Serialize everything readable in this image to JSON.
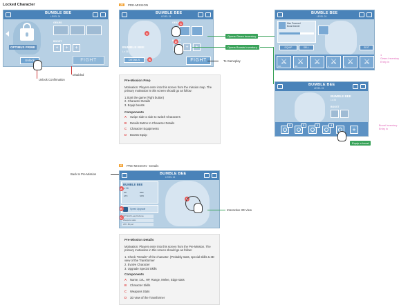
{
  "colors": {
    "accent": "#4a83b9",
    "callout": "#3aa35a",
    "marker": "#e85a5a",
    "pink": "#e05fb5",
    "badge": "#f3a53a"
  },
  "locked": {
    "section_title": "Locked Character",
    "char_title": "BUMBLE BEE",
    "char_level": "LEVEL 24",
    "gears": "GEARS",
    "boost": "BOOST",
    "name": "OPTIMUS PRIME",
    "unlock": "Unlock",
    "fight": "FIGHT",
    "unlock_note": "Unlock Confirmation",
    "disabled_note": "Disabled",
    "icon": "lock-icon"
  },
  "premission": {
    "badge": "22",
    "title": "PRE-MISSION",
    "char_title": "BUMBLE BEE",
    "char_level": "LEVEL 24",
    "gears": "GEARS",
    "boost": "BOOST",
    "name": "BUMBLE BEE",
    "lv": "Lv 26",
    "details": "DETAILS",
    "fight": "FIGHT",
    "to_gameplay": "To Gameplay",
    "opens_gears": "Opens Gears Inventory",
    "opens_boosts": "Opens Boosts Inventory",
    "markers": {
      "a": "A",
      "b": "B",
      "c": "C",
      "d": "D"
    }
  },
  "prep": {
    "heading": "Pre-Mission Prep",
    "motivation": "Motivation: Players enter into this screen from the mission map. The primary motivation is this screen should go as follow:",
    "steps": [
      "1.Start the game (Fight button)",
      "2. Character Details",
      "3. Equip boosts"
    ],
    "components_title": "Components",
    "components": [
      {
        "key": "A",
        "text": "Swipe side to side to switch Characters"
      },
      {
        "key": "B",
        "text": "Details Button to Character Details"
      },
      {
        "key": "C",
        "text": "Character Equipments"
      },
      {
        "key": "D",
        "text": "Boosts Equip"
      }
    ]
  },
  "gears_inv": {
    "char_title": "BUMBLE BEE",
    "char_level": "LEVEL 24",
    "stat1": "Max Powered",
    "stat2": "Boost Damet",
    "equip": "EQUIP",
    "sell": "SELL",
    "edit": "EDIT",
    "weapon_labels": [
      "UC",
      "UC",
      "L",
      "L"
    ],
    "note": "1\nGears Inventory\nEntry in"
  },
  "boost_inv": {
    "char_title": "BUMBLE BEE",
    "char_level": "LEVEL 24",
    "name": "BUMBLE BEE",
    "lv": "Lv 26",
    "boost": "BOOST",
    "badges": [
      "2",
      "3",
      "1",
      "4"
    ],
    "equip_callout": "Equip a boost",
    "note": "Boost Inventory\nEntry in"
  },
  "details": {
    "badge": "6",
    "title": "PRE-MISSION - Details",
    "back_note": "Back to Pre-Mission",
    "char_title": "BUMBLE BEE",
    "char_level": "LEVEL 24",
    "name": "BUMBLE BEE",
    "lv": "Lv 26",
    "stats": [
      "HP",
      "ATK",
      "DEF",
      "SPD"
    ],
    "skill_label": "Speed Upgrade",
    "weapon_rows": [
      "HP:Stitch Leap Defense",
      "Weapons stats",
      "ATK: 80 pwr"
    ],
    "view_note": "Interactive 3D View",
    "markers": {
      "a": "A",
      "b": "B",
      "c": "C",
      "d": "D"
    }
  },
  "details_doc": {
    "heading": "Pre-Mission Details",
    "motivation": "Motivation: Players enter into this screen from the Pre-Mission. The primary motivation in this screen should go as follow:",
    "steps": [
      "1. Check \"Details\" of the character. (Probably stats, special skills & 3D view of the Transformer",
      "2. Evolve Character",
      "3. Upgrade Special Skills"
    ],
    "components_title": "Components",
    "components": [
      {
        "key": "A",
        "text": "Name, LVL, HP, Range, Melee, Edge stats"
      },
      {
        "key": "B",
        "text": "Character Skills"
      },
      {
        "key": "C",
        "text": "Weapons Stats"
      },
      {
        "key": "D",
        "text": "3D view of the Transformer"
      }
    ]
  }
}
